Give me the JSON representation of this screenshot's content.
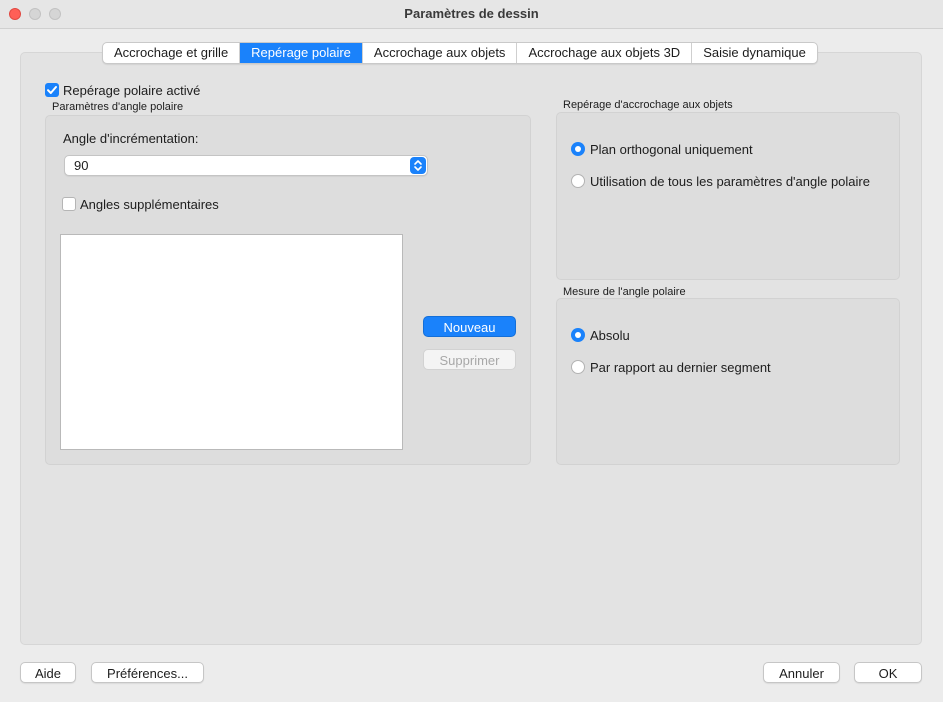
{
  "window": {
    "title": "Paramètres de dessin"
  },
  "tabs": [
    {
      "label": "Accrochage et grille",
      "active": false
    },
    {
      "label": "Repérage polaire",
      "active": true
    },
    {
      "label": "Accrochage aux objets",
      "active": false
    },
    {
      "label": "Accrochage aux objets 3D",
      "active": false
    },
    {
      "label": "Saisie dynamique",
      "active": false
    }
  ],
  "polar_tracking": {
    "enabled_label": "Repérage polaire activé",
    "enabled": true,
    "angle_settings": {
      "group_label": "Paramètres d'angle polaire",
      "increment_label": "Angle d'incrémentation:",
      "increment_value": "90",
      "additional_angles_label": "Angles supplémentaires",
      "additional_angles_checked": false,
      "new_button": "Nouveau",
      "delete_button": "Supprimer"
    }
  },
  "object_snap_tracking": {
    "group_label": "Repérage d'accrochage aux objets",
    "options": [
      {
        "label": "Plan orthogonal uniquement",
        "selected": true
      },
      {
        "label": "Utilisation de tous les paramètres d'angle polaire",
        "selected": false
      }
    ]
  },
  "angle_measure": {
    "group_label": "Mesure de l'angle polaire",
    "options": [
      {
        "label": "Absolu",
        "selected": true
      },
      {
        "label": "Par rapport au dernier segment",
        "selected": false
      }
    ]
  },
  "footer": {
    "help_button": "Aide",
    "preferences_button": "Préférences...",
    "cancel_button": "Annuler",
    "ok_button": "OK"
  },
  "colors": {
    "accent": "#1a82fb",
    "close": "#ff5f57"
  }
}
